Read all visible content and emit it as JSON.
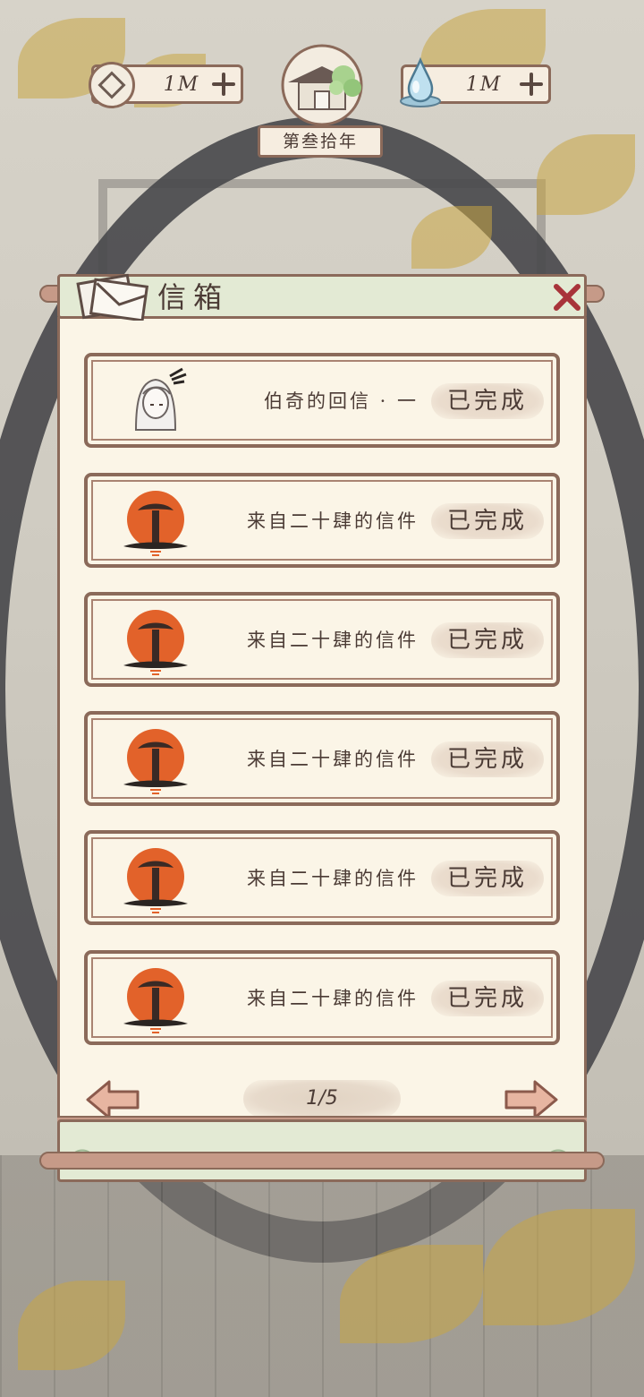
{
  "hud": {
    "coins": {
      "icon": "coin-icon",
      "value": "1M"
    },
    "essence": {
      "icon": "water-drop-icon",
      "value": "1M"
    },
    "year_label": "第叁拾年"
  },
  "mailbox": {
    "title": "信箱",
    "letters": [
      {
        "title": "伯奇的回信 · 一",
        "status": "已完成",
        "avatar": "white-haired-character-portrait"
      },
      {
        "title": "来自二十肆的信件",
        "status": "已完成",
        "avatar": "orange-sun-seal"
      },
      {
        "title": "来自二十肆的信件",
        "status": "已完成",
        "avatar": "orange-sun-seal"
      },
      {
        "title": "来自二十肆的信件",
        "status": "已完成",
        "avatar": "orange-sun-seal"
      },
      {
        "title": "来自二十肆的信件",
        "status": "已完成",
        "avatar": "orange-sun-seal"
      },
      {
        "title": "来自二十肆的信件",
        "status": "已完成",
        "avatar": "orange-sun-seal"
      }
    ],
    "pagination": {
      "label": "1/5"
    }
  },
  "colors": {
    "frame_brown": "#8b6a5a",
    "parchment": "#fbf5e7",
    "header_green": "#e3ead4",
    "close_red": "#a8343a",
    "seal_orange": "#e2622a"
  }
}
